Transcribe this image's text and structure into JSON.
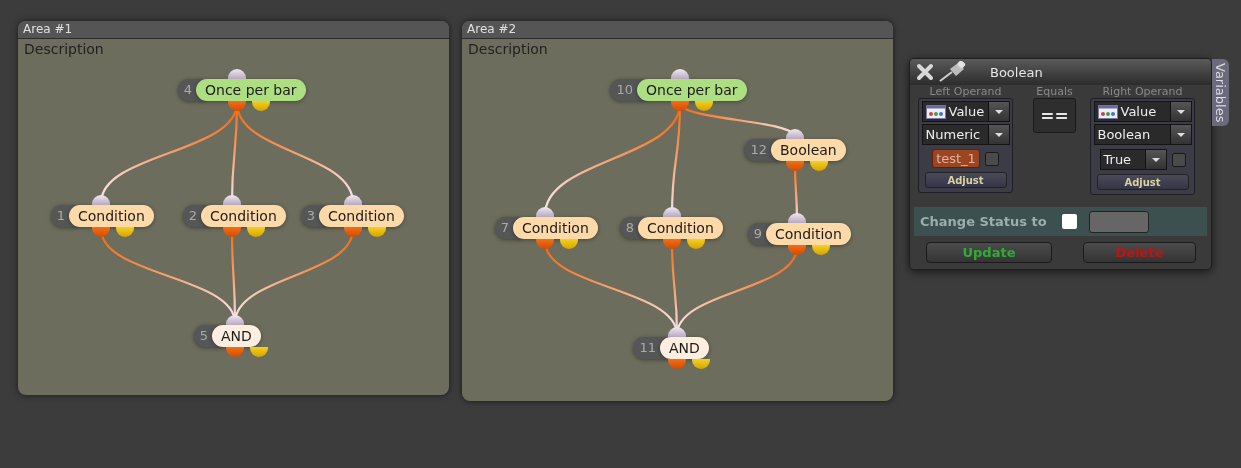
{
  "areas": [
    {
      "title": "Area #1",
      "description": "Description",
      "nodes": [
        {
          "number": "4",
          "label": "Once per bar",
          "kind": "trigger"
        },
        {
          "number": "1",
          "label": "Condition",
          "kind": "condition"
        },
        {
          "number": "2",
          "label": "Condition",
          "kind": "condition"
        },
        {
          "number": "3",
          "label": "Condition",
          "kind": "condition"
        },
        {
          "number": "5",
          "label": "AND",
          "kind": "logic"
        }
      ]
    },
    {
      "title": "Area #2",
      "description": "Description",
      "nodes": [
        {
          "number": "10",
          "label": "Once per bar",
          "kind": "trigger"
        },
        {
          "number": "12",
          "label": "Boolean",
          "kind": "condition"
        },
        {
          "number": "7",
          "label": "Condition",
          "kind": "condition"
        },
        {
          "number": "8",
          "label": "Condition",
          "kind": "condition"
        },
        {
          "number": "9",
          "label": "Condition",
          "kind": "condition"
        },
        {
          "number": "11",
          "label": "AND",
          "kind": "logic"
        }
      ]
    }
  ],
  "dialog": {
    "title": "Boolean",
    "side_tab": "Variables",
    "left": {
      "heading": "Left Operand",
      "source": "Value",
      "type": "Numeric",
      "value": "test_1",
      "checked": false,
      "button": "Adjust"
    },
    "operator": {
      "heading": "Equals",
      "symbol": "=="
    },
    "right": {
      "heading": "Right Operand",
      "source": "Value",
      "type": "Boolean",
      "value": "True",
      "checked": false,
      "button": "Adjust"
    },
    "status": {
      "label": "Change Status to",
      "checked": false
    },
    "buttons": [
      {
        "label": "Update",
        "kind": "confirm"
      },
      {
        "label": "Delete",
        "kind": "danger"
      }
    ]
  }
}
